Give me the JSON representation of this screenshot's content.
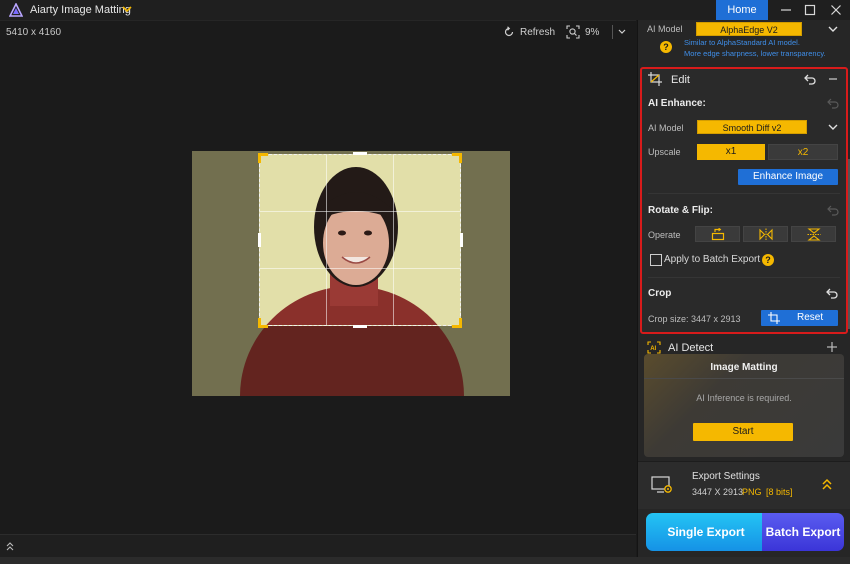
{
  "titlebar": {
    "app_title": "Aiarty Image Matting",
    "home_label": "Home",
    "icons": [
      "app-logo-icon",
      "chevron-down-icon",
      "minimize-icon",
      "maximize-icon",
      "close-icon"
    ]
  },
  "canvas": {
    "image_dims": "5410 x 4160",
    "refresh_label": "Refresh",
    "zoom_label": "9%"
  },
  "panel": {
    "top": {
      "ai_model_label": "AI Model",
      "ai_model_value": "AlphaEdge  V2",
      "hint_line1": "Similar to AlphaStandard AI model.",
      "hint_line2": "More edge sharpness, lower transparency.",
      "hint_icon": "?"
    },
    "edit": {
      "title": "Edit",
      "ai_enhance_title": "AI Enhance:",
      "ai_model_label": "AI Model",
      "ai_model_value": "Smooth Diff v2",
      "upscale_label": "Upscale",
      "upscale_options": [
        "x1",
        "x2"
      ],
      "upscale_selected": "x1",
      "enhance_button": "Enhance Image",
      "rotate_title": "Rotate & Flip:",
      "operate_label": "Operate",
      "batch_label": "Apply to Batch Export",
      "batch_checked": false,
      "crop_title": "Crop",
      "crop_size": "Crop size: 3447 x 2913",
      "reset_button": "Reset"
    },
    "ai_detect": {
      "title": "AI Detect",
      "card_title": "Image Matting",
      "card_note": "AI Inference is required.",
      "start_button": "Start"
    },
    "export": {
      "settings_title": "Export Settings",
      "size": "3447 X 2913",
      "format": "PNG",
      "bits": "[8 bits]",
      "single_export": "Single Export",
      "batch_export": "Batch Export"
    }
  },
  "colors": {
    "accent_yellow": "#f5b800",
    "accent_blue": "#1f6fd6",
    "highlight_red": "#d81b1b",
    "hint_blue": "#3f8ee8"
  }
}
